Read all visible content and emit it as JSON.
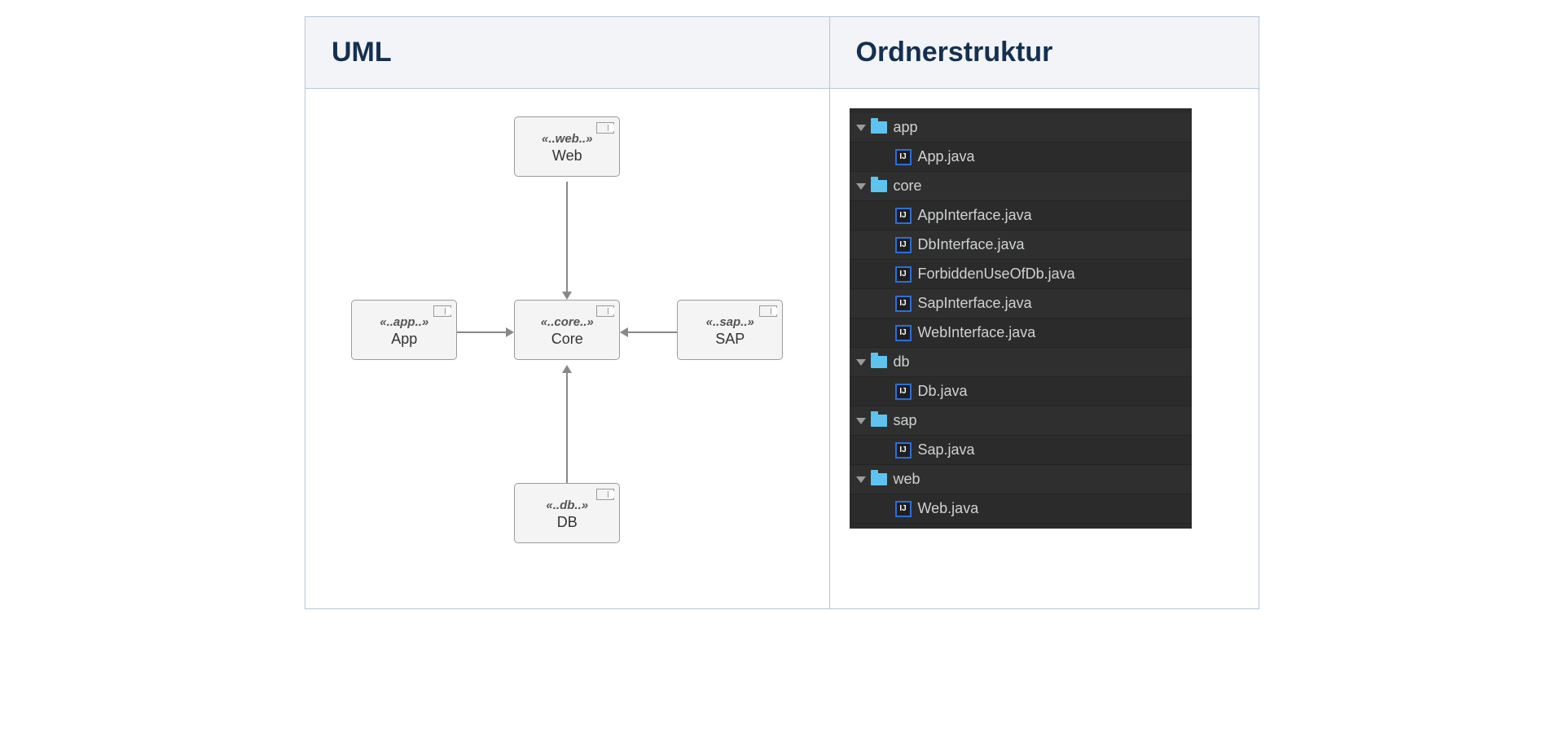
{
  "columns": {
    "left_header": "UML",
    "right_header": "Ordnerstruktur"
  },
  "uml": {
    "web": {
      "stereo": "«..web..»",
      "name": "Web"
    },
    "app": {
      "stereo": "«..app..»",
      "name": "App"
    },
    "core": {
      "stereo": "«..core..»",
      "name": "Core"
    },
    "sap": {
      "stereo": "«..sap..»",
      "name": "SAP"
    },
    "db": {
      "stereo": "«..db..»",
      "name": "DB"
    }
  },
  "icon_labels": {
    "java_badge": "IJ"
  },
  "tree": [
    {
      "type": "folder",
      "label": "app",
      "depth": 0,
      "expanded": true
    },
    {
      "type": "file",
      "label": "App.java",
      "depth": 1
    },
    {
      "type": "folder",
      "label": "core",
      "depth": 0,
      "expanded": true
    },
    {
      "type": "file",
      "label": "AppInterface.java",
      "depth": 1
    },
    {
      "type": "file",
      "label": "DbInterface.java",
      "depth": 1
    },
    {
      "type": "file",
      "label": "ForbiddenUseOfDb.java",
      "depth": 1
    },
    {
      "type": "file",
      "label": "SapInterface.java",
      "depth": 1
    },
    {
      "type": "file",
      "label": "WebInterface.java",
      "depth": 1
    },
    {
      "type": "folder",
      "label": "db",
      "depth": 0,
      "expanded": true
    },
    {
      "type": "file",
      "label": "Db.java",
      "depth": 1
    },
    {
      "type": "folder",
      "label": "sap",
      "depth": 0,
      "expanded": true
    },
    {
      "type": "file",
      "label": "Sap.java",
      "depth": 1
    },
    {
      "type": "folder",
      "label": "web",
      "depth": 0,
      "expanded": true
    },
    {
      "type": "file",
      "label": "Web.java",
      "depth": 1
    }
  ]
}
